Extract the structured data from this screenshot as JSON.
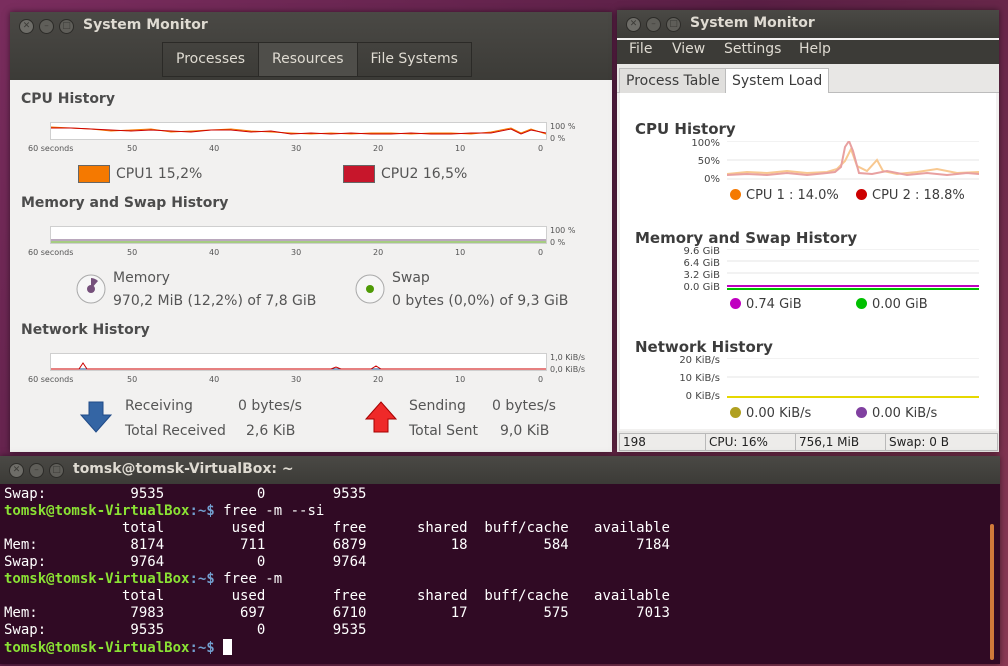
{
  "left_window": {
    "title": "System Monitor",
    "tabs": [
      "Processes",
      "Resources",
      "File Systems"
    ],
    "active_tab": "Resources",
    "cpu": {
      "heading": "CPU History",
      "x_ticks": [
        "60 seconds",
        "50",
        "40",
        "30",
        "20",
        "10",
        "0"
      ],
      "y_ticks": [
        "100 %",
        "0 %"
      ],
      "cpu1_label": "CPU1",
      "cpu1_value": "15,2%",
      "cpu2_label": "CPU2",
      "cpu2_value": "16,5%",
      "cpu1_color": "#f57900",
      "cpu2_color": "#cc0000"
    },
    "memory": {
      "heading": "Memory and Swap History",
      "x_ticks": [
        "60 seconds",
        "50",
        "40",
        "30",
        "20",
        "10",
        "0"
      ],
      "y_ticks": [
        "100 %",
        "0 %"
      ],
      "memory_label": "Memory",
      "memory_value": "970,2 MiB (12,2%) of 7,8 GiB",
      "swap_label": "Swap",
      "swap_value": "0 bytes (0,0%) of 9,3 GiB"
    },
    "network": {
      "heading": "Network History",
      "x_ticks": [
        "60 seconds",
        "50",
        "40",
        "30",
        "20",
        "10",
        "0"
      ],
      "y_ticks": [
        "1,0 KiB/s",
        "0,0 KiB/s"
      ],
      "receiving_label": "Receiving",
      "receiving_value": "0 bytes/s",
      "total_received_label": "Total Received",
      "total_received_value": "2,6 KiB",
      "sending_label": "Sending",
      "sending_value": "0 bytes/s",
      "total_sent_label": "Total Sent",
      "total_sent_value": "9,0 KiB"
    }
  },
  "right_window": {
    "title": "System Monitor",
    "menu": [
      "File",
      "View",
      "Settings",
      "Help"
    ],
    "tabs": [
      "Process Table",
      "System Load"
    ],
    "active_tab": "System Load",
    "cpu": {
      "heading": "CPU History",
      "y_ticks": [
        "100%",
        "50%",
        "0%"
      ],
      "cpu1": "CPU 1 : 14.0%",
      "cpu2": "CPU 2 : 18.8%",
      "cpu1_color": "#f57900",
      "cpu2_color": "#cc0000"
    },
    "memory": {
      "heading": "Memory and Swap History",
      "y_ticks": [
        "9.6 GiB",
        "6.4 GiB",
        "3.2 GiB",
        "0.0 GiB"
      ],
      "mem_value": "0.74 GiB",
      "swap_value": "0.00 GiB",
      "mem_color": "#c000c0",
      "swap_color": "#00c000"
    },
    "network": {
      "heading": "Network History",
      "y_ticks": [
        "20 KiB/s",
        "10 KiB/s",
        "0 KiB/s"
      ],
      "in_value": "0.00 KiB/s",
      "out_value": "0.00 KiB/s",
      "in_color": "#b0a020",
      "out_color": "#8040a0"
    },
    "status": {
      "processes": "198",
      "cpu": "CPU: 16%",
      "mem": "756,1 MiB",
      "swap": "Swap: 0 B"
    }
  },
  "terminal": {
    "title": "tomsk@tomsk-VirtualBox: ~",
    "prompt_user": "tomsk@tomsk-VirtualBox",
    "prompt_path": ":~$",
    "lines": [
      {
        "type": "out",
        "text": "Swap:          9535           0        9535"
      },
      {
        "type": "cmd",
        "text": " free -m --si"
      },
      {
        "type": "out",
        "text": "              total        used        free      shared  buff/cache   available"
      },
      {
        "type": "out",
        "text": "Mem:           8174         711        6879          18         584        7184"
      },
      {
        "type": "out",
        "text": "Swap:          9764           0        9764"
      },
      {
        "type": "cmd",
        "text": " free -m"
      },
      {
        "type": "out",
        "text": "              total        used        free      shared  buff/cache   available"
      },
      {
        "type": "out",
        "text": "Mem:           7983         697        6710          17         575        7013"
      },
      {
        "type": "out",
        "text": "Swap:          9535           0        9535"
      },
      {
        "type": "cmd",
        "text": " "
      }
    ]
  }
}
